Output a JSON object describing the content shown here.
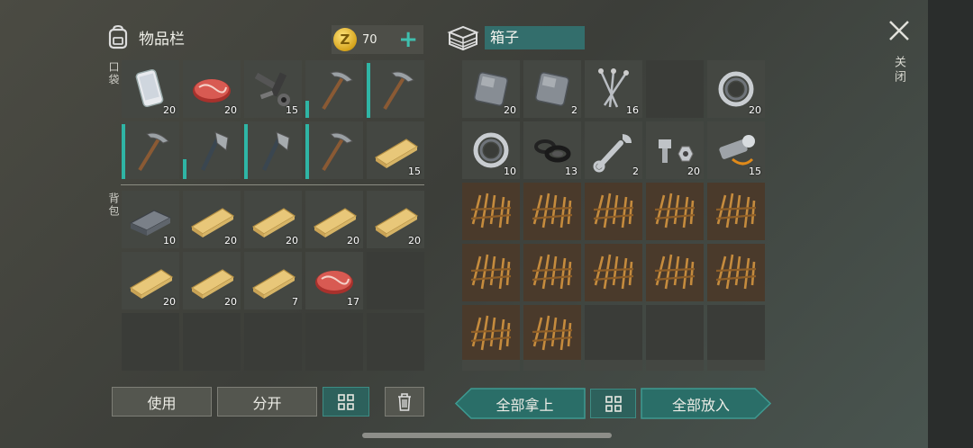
{
  "inventory": {
    "title": "物品栏",
    "coins": "70",
    "coin_symbol": "Z",
    "plus": "+",
    "pocket_label": "口袋",
    "backpack_label": "背包",
    "pocket_slots": [
      {
        "item": "phone-icon",
        "count": "20"
      },
      {
        "item": "meat-icon",
        "count": "20"
      },
      {
        "item": "gun-parts-icon",
        "count": "15"
      },
      {
        "item": "pickaxe-icon",
        "count": "",
        "durability": 0.3
      },
      {
        "item": "pickaxe-icon",
        "count": "",
        "durability": 0.95
      },
      {
        "item": "pickaxe-icon",
        "count": "",
        "durability": 0.95
      },
      {
        "item": "hatchet-icon",
        "count": "",
        "durability": 0.35
      },
      {
        "item": "hatchet-icon",
        "count": "",
        "durability": 0.95
      },
      {
        "item": "pickaxe-icon",
        "count": "",
        "durability": 0.95
      },
      {
        "item": "plank-icon",
        "count": "15"
      }
    ],
    "backpack_slots": [
      {
        "item": "iron-ingot-icon",
        "count": "10"
      },
      {
        "item": "plank-icon",
        "count": "20"
      },
      {
        "item": "plank-icon",
        "count": "20"
      },
      {
        "item": "plank-icon",
        "count": "20"
      },
      {
        "item": "plank-icon",
        "count": "20"
      },
      {
        "item": "plank-icon",
        "count": "20"
      },
      {
        "item": "plank-icon",
        "count": "20"
      },
      {
        "item": "plank-icon",
        "count": "7"
      },
      {
        "item": "meat-icon",
        "count": "17"
      },
      {
        "item": "",
        "count": ""
      },
      {
        "item": "",
        "count": ""
      },
      {
        "item": "",
        "count": ""
      },
      {
        "item": "",
        "count": ""
      },
      {
        "item": "",
        "count": ""
      },
      {
        "item": "",
        "count": ""
      }
    ]
  },
  "box": {
    "title": "箱子",
    "slots": [
      {
        "item": "metal-plate-icon",
        "count": "20"
      },
      {
        "item": "metal-plate-icon",
        "count": "2"
      },
      {
        "item": "nails-icon",
        "count": "16"
      },
      {
        "item": "",
        "count": ""
      },
      {
        "item": "bearing-icon",
        "count": "20"
      },
      {
        "item": "bearing-icon",
        "count": "10"
      },
      {
        "item": "rubber-rings-icon",
        "count": "13"
      },
      {
        "item": "wrench-icon",
        "count": "2"
      },
      {
        "item": "bolt-nut-icon",
        "count": "20"
      },
      {
        "item": "flashlight-icon",
        "count": "15"
      },
      {
        "item": "wooden-spikes-icon",
        "count": ""
      },
      {
        "item": "wooden-spikes-icon",
        "count": ""
      },
      {
        "item": "wooden-spikes-icon",
        "count": ""
      },
      {
        "item": "wooden-spikes-icon",
        "count": ""
      },
      {
        "item": "wooden-spikes-icon",
        "count": ""
      },
      {
        "item": "wooden-spikes-icon",
        "count": ""
      },
      {
        "item": "wooden-spikes-icon",
        "count": ""
      },
      {
        "item": "wooden-spikes-icon",
        "count": ""
      },
      {
        "item": "wooden-spikes-icon",
        "count": ""
      },
      {
        "item": "wooden-spikes-icon",
        "count": ""
      },
      {
        "item": "wooden-spikes-icon",
        "count": ""
      },
      {
        "item": "wooden-spikes-icon",
        "count": ""
      },
      {
        "item": "",
        "count": ""
      },
      {
        "item": "",
        "count": ""
      },
      {
        "item": "",
        "count": ""
      }
    ]
  },
  "close_label": "关闭",
  "buttons": {
    "use": "使用",
    "split": "分开",
    "take_all": "全部拿上",
    "put_all": "全部放入"
  },
  "colors": {
    "accent": "#2fb5a5",
    "teal_button": "#2a6e68",
    "slot": "#444742"
  }
}
